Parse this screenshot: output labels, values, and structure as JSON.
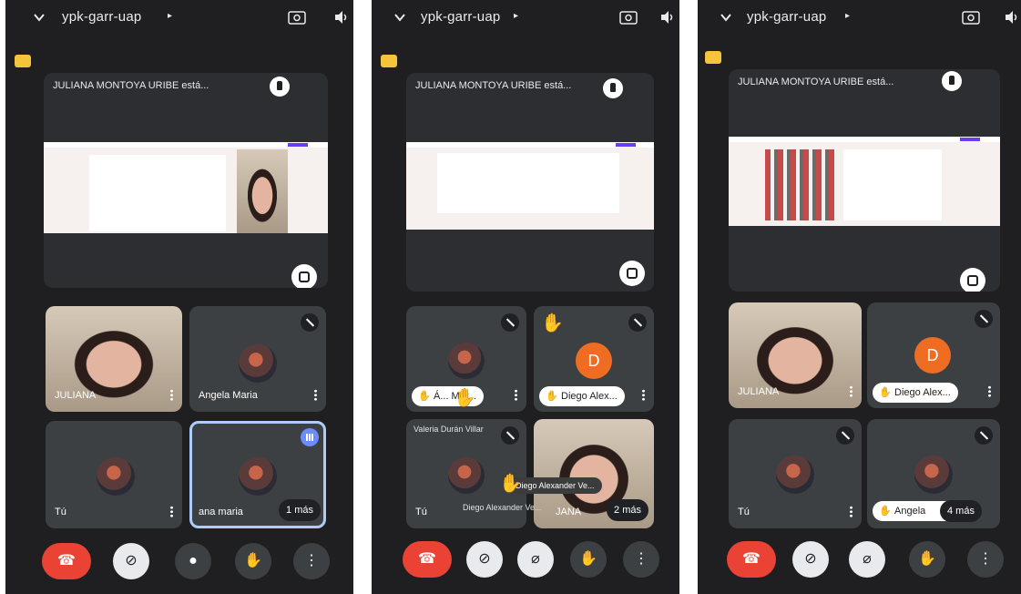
{
  "meeting_title": "ypk-garr-uap",
  "presenter_text": "JULIANA MONTOYA URIBE está...",
  "panel1": {
    "tiles": [
      {
        "name": "JULIANA"
      },
      {
        "name": "Angela Maria"
      },
      {
        "name": "Tú"
      },
      {
        "name": "ana maria",
        "more": "1 más"
      }
    ]
  },
  "panel2": {
    "pills": [
      "Á... Mar...",
      "Diego Alex..."
    ],
    "letter": "D",
    "overlay_name": "Valeria Durán Villar",
    "toast": "Diego Alexander Ve...",
    "bottom_caption": "Diego Alexander Ve...",
    "left_name": "Tú",
    "right_name": "JANA",
    "more": "2 más"
  },
  "panel3": {
    "tiles": [
      {
        "name": "JULIANA"
      },
      {
        "name": "Diego Alex...",
        "letter": "D"
      },
      {
        "name": "Tú"
      },
      {
        "name": "Angela",
        "more": "4 más"
      }
    ]
  },
  "icons": [
    "chevron-down-icon",
    "camera-switch-icon",
    "speaker-icon",
    "pin-icon",
    "fullscreen-icon",
    "mic-off-icon",
    "more-vert-icon",
    "hand-icon",
    "end-call-icon",
    "camera-off-icon",
    "mic-icon"
  ],
  "colors": {
    "end_call": "#ea4335",
    "avatar_orange": "#ee6d22",
    "tile_bg": "#3c4043",
    "selected_outline": "#aecbfa"
  }
}
